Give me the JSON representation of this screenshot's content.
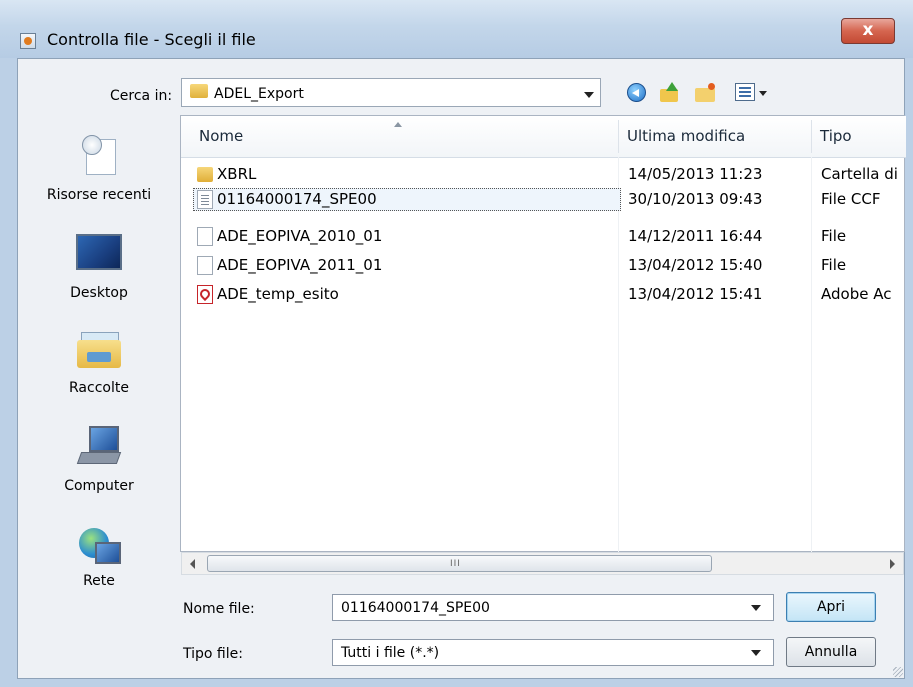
{
  "window": {
    "title": "Controlla file - Scegli il file",
    "close_glyph": "x"
  },
  "toolbar": {
    "lookin_label": "Cerca in:",
    "lookin_value": "ADEL_Export",
    "icons": [
      "back-icon",
      "up-folder-icon",
      "new-folder-icon",
      "view-menu-icon"
    ]
  },
  "sidebar": {
    "items": [
      {
        "label": "Risorse recenti",
        "icon": "recent-places-icon"
      },
      {
        "label": "Desktop",
        "icon": "desktop-icon"
      },
      {
        "label": "Raccolte",
        "icon": "libraries-icon"
      },
      {
        "label": "Computer",
        "icon": "computer-icon"
      },
      {
        "label": "Rete",
        "icon": "network-icon"
      }
    ]
  },
  "file_list": {
    "columns": [
      "Nome",
      "Ultima modifica",
      "Tipo"
    ],
    "rows": [
      {
        "name": "XBRL",
        "modified": "14/05/2013 11:23",
        "type": "Cartella di",
        "icon": "folder-icon",
        "selected": false
      },
      {
        "name": "01164000174_SPE00",
        "modified": "30/10/2013 09:43",
        "type": "File CCF",
        "icon": "document-icon",
        "selected": true
      },
      {
        "name": "ADE_EOPIVA_2010_01",
        "modified": "14/12/2011 16:44",
        "type": "File",
        "icon": "blank-file-icon",
        "selected": false
      },
      {
        "name": "ADE_EOPIVA_2011_01",
        "modified": "13/04/2012 15:40",
        "type": "File",
        "icon": "blank-file-icon",
        "selected": false
      },
      {
        "name": "ADE_temp_esito",
        "modified": "13/04/2012 15:41",
        "type": "Adobe Ac",
        "icon": "pdf-icon",
        "selected": false
      }
    ]
  },
  "scrollbar": {
    "grip": "III"
  },
  "footer": {
    "filename_label": "Nome file:",
    "filename_value": "01164000174_SPE00",
    "filetype_label": "Tipo file:",
    "filetype_value": "Tutti i file (*.*)",
    "open_button": "Apri",
    "cancel_button": "Annulla"
  },
  "colors": {
    "title_gradient": "#c3d6ea",
    "close_button": "#d5654f",
    "selection_fill": "#eef5fc",
    "default_button": "#c4e5f6"
  }
}
